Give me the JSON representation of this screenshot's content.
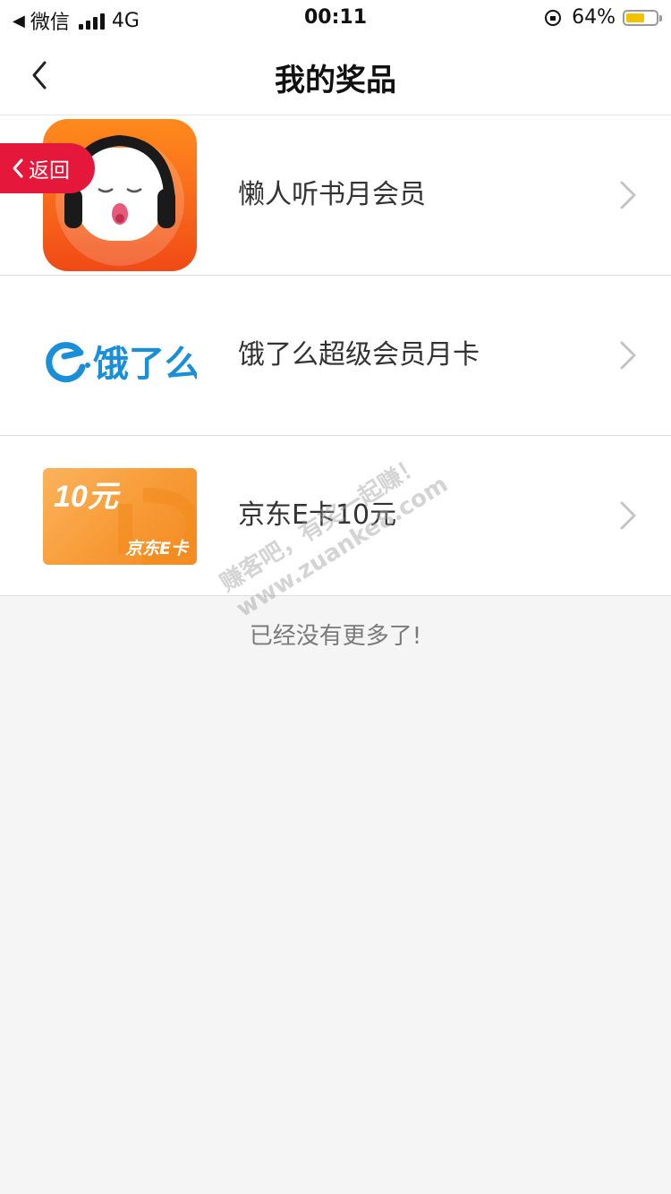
{
  "status_bar": {
    "back_app": "微信",
    "network": "4G",
    "time": "00:11",
    "battery_percent": "64%",
    "battery_level": 0.64,
    "battery_color": "#f2c200"
  },
  "nav": {
    "title": "我的奖品",
    "back_icon": "chevron-left-icon"
  },
  "return_badge": {
    "label": "返回",
    "color": "#e5183c"
  },
  "prizes": [
    {
      "label": "懒人听书月会员",
      "thumb": "lanren-app-icon"
    },
    {
      "label": "饿了么超级会员月卡",
      "thumb": "eleme-logo",
      "logo_text": "饿了么"
    },
    {
      "label": "京东E卡10元",
      "thumb": "jd-ecard",
      "card_amount": "10元",
      "card_brand": "京东E卡"
    }
  ],
  "footer_note": "已经没有更多了!",
  "watermark": {
    "line1": "赚客吧，有奖一起赚！",
    "line2": "www.zuanke8.com"
  }
}
